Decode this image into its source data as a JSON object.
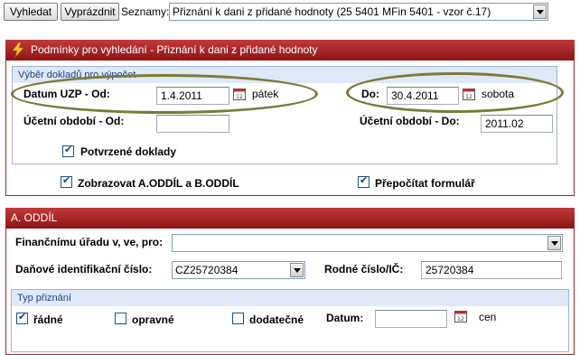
{
  "toolbar": {
    "search_label": "Vyhledat",
    "clear_label": "Vyprázdnit",
    "lists_label": "Seznamy:",
    "list_selected": "Přiznání k dani z přidané hodnoty (25 5401 MFin 5401 - vzor č.17)"
  },
  "conditions_panel": {
    "title": "Podmínky pro vyhledání - Přiznání k dani z přidané hodnoty",
    "docs_group_title": "Výběr dokladů pro výpočet",
    "date_from_label": "Datum UZP - Od:",
    "date_from_value": "1.4.2011",
    "date_from_day": "pátek",
    "date_to_label": "Do:",
    "date_to_value": "30.4.2011",
    "date_to_day": "sobota",
    "period_from_label": "Účetní období - Od:",
    "period_from_value": "",
    "period_to_label": "Účetní období - Do:",
    "period_to_value": "2011.02",
    "confirmed_docs_label": "Potvrzené doklady",
    "show_sections_label": "Zobrazovat A.ODDÍL a B.ODDÍL",
    "recalc_label": "Přepočítat formulář"
  },
  "section_a": {
    "title": "A. ODDÍL",
    "tax_office_label": "Finančnímu úřadu v, ve, pro:",
    "tax_office_value": "",
    "tax_id_label": "Daňové identifikační číslo:",
    "tax_id_value": "CZ25720384",
    "birth_no_label": "Rodné číslo/IČ:",
    "birth_no_value": "25720384",
    "type_group_title": "Typ přiznání",
    "regular_label": "řádné",
    "corrective_label": "opravné",
    "additional_label": "dodatečné",
    "date_label": "Datum:",
    "date_value": "",
    "date_suffix": "cen"
  },
  "colors": {
    "panel_header": "#a52222",
    "annotation_ellipse": "#7a7a3a",
    "group_header": "#dfe8f6"
  }
}
